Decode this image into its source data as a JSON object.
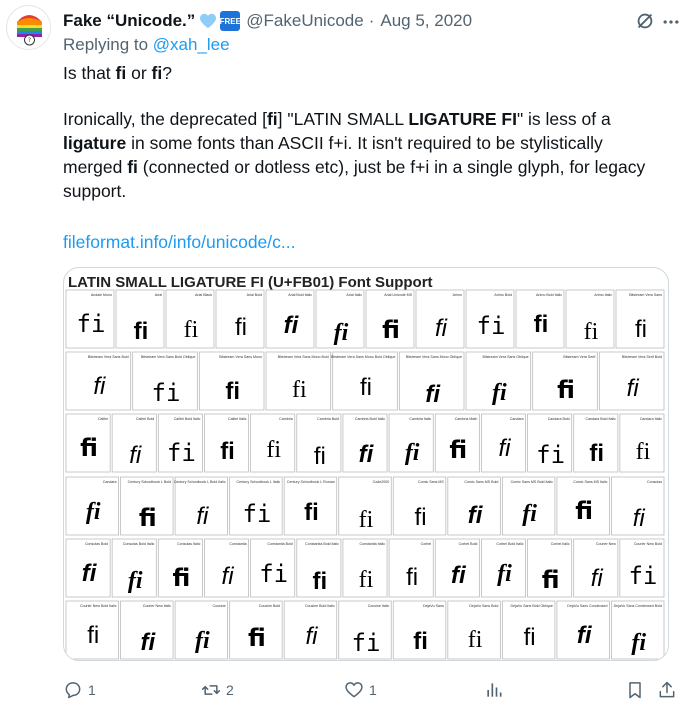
{
  "tweet": {
    "display_name": "Fake “Unicode.”",
    "badge": "FREE",
    "handle": "@FakeUnicode",
    "separator": "·",
    "date": "Aug 5, 2020",
    "replying_prefix": "Replying to ",
    "replying_to": "@xah_lee",
    "line1": [
      "Is that ",
      "fi",
      " or ",
      "fi",
      "?"
    ],
    "p2_runs": [
      [
        "Ironically, the deprecated [",
        false
      ],
      [
        "fi",
        true
      ],
      [
        "] \"LATIN SMALL ",
        false
      ],
      [
        "LIGATURE FI",
        true
      ],
      [
        "\" is less of a ",
        false
      ],
      [
        "ligature",
        true
      ],
      [
        " in some fonts than ASCII f+i. It isn't required to be stylistically merged ",
        false
      ],
      [
        "fi",
        true
      ],
      [
        " (connected or dotless etc), just be f+i in a single glyph, for legacy support.",
        false
      ]
    ],
    "link": "fileformat.info/info/unicode/c..."
  },
  "media": {
    "title": "LATIN SMALL LIGATURE FI (U+FB01) Font Support",
    "glyph": "fi",
    "rows": [
      [
        "Andale Mono",
        "Arial",
        "Arial Black",
        "Arial Bold",
        "Arial Bold Italic",
        "Arial Italic",
        "Arial Unicode MS",
        "Arimo",
        "Arimo Bold",
        "Arimo Bold Italic",
        "Arimo Italic",
        "Bitstream Vera Sans"
      ],
      [
        "Bitstream Vera Sans Bold",
        "Bitstream Vera Sans Bold Oblique",
        "Bitstream Vera Sans Mono",
        "Bitstream Vera Sans Mono Bold",
        "Bitstream Vera Sans Mono Bold Oblique",
        "Bitstream Vera Sans Mono Oblique",
        "Bitstream Vera Sans Oblique",
        "Bitstream Vera Serif",
        "Bitstream Vera Serif Bold"
      ],
      [
        "Calibri",
        "Calibri Bold",
        "Calibri Bold Italic",
        "Calibri Italic",
        "Cambria",
        "Cambria Bold",
        "Cambria Bold Italic",
        "Cambria Italic",
        "Cambria Math",
        "Candara",
        "Candara Bold",
        "Candara Bold Italic",
        "Candara Italic"
      ],
      [
        "Candara",
        "Century Schoolbook L Bold",
        "Century Schoolbook L Bold Italic",
        "Century Schoolbook L Italic",
        "Century Schoolbook L Roman",
        "Code2000",
        "Comic Sans MS",
        "Comic Sans MS Bold",
        "Comic Sans MS Bold Italic",
        "Comic Sans MS Italic",
        "Consolas"
      ],
      [
        "Consolas Bold",
        "Consolas Bold Italic",
        "Consolas Italic",
        "Constantia",
        "Constantia Bold",
        "Constantia Bold Italic",
        "Constantia Italic",
        "Corbel",
        "Corbel Bold",
        "Corbel Bold Italic",
        "Corbel Italic",
        "Courier New",
        "Courier New Bold"
      ],
      [
        "Courier New Bold Italic",
        "Courier New Italic",
        "Cousine",
        "Cousine Bold",
        "Cousine Bold Italic",
        "Cousine Italic",
        "DejaVu Sans",
        "DejaVu Sans Bold",
        "DejaVu Sans Bold Oblique",
        "DejaVu Sans Condensed",
        "DejaVu Sans Condensed Bold"
      ]
    ]
  },
  "actions": {
    "reply_count": "1",
    "retweet_count": "2",
    "like_count": "1"
  },
  "colors": {
    "link": "#1d9bf0",
    "secondary_text": "#536471",
    "badge": "#1d73d8",
    "heart": "#8ecdf7"
  }
}
